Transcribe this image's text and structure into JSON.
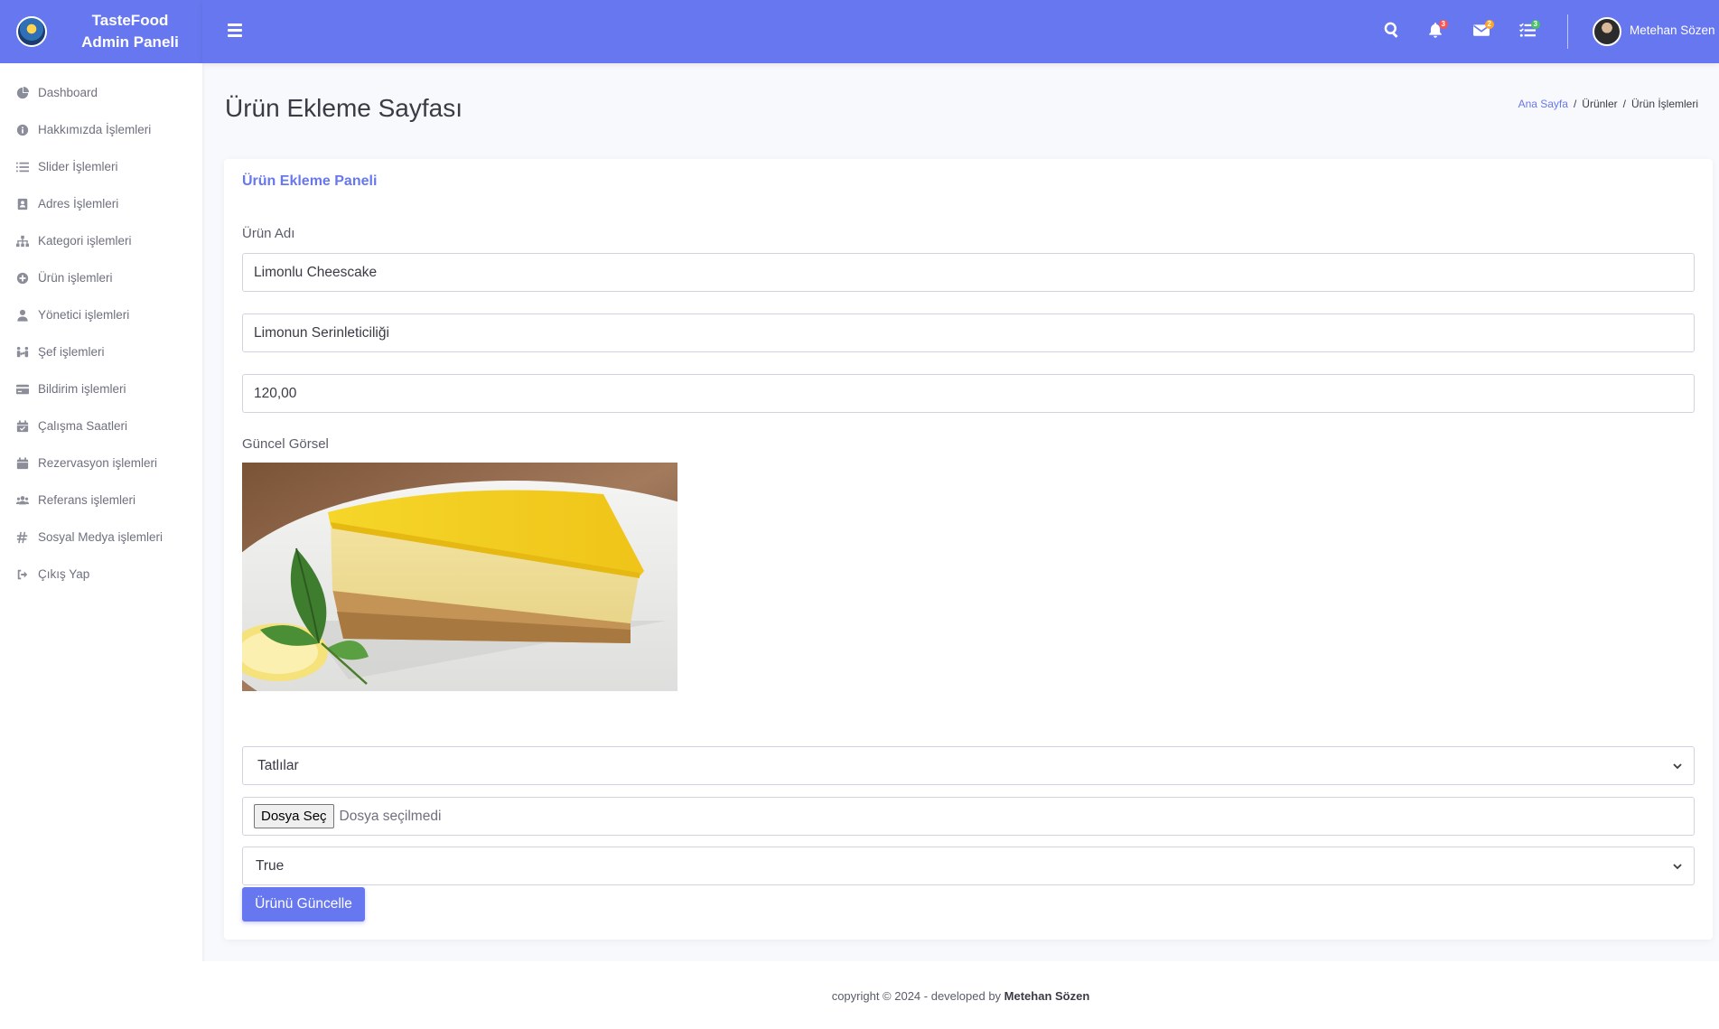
{
  "brand": {
    "line1": "TasteFood",
    "line2": "Admin Paneli"
  },
  "sidebar": {
    "items": [
      {
        "label": "Dashboard",
        "icon": "chart-pie-icon"
      },
      {
        "label": "Hakkımızda İşlemleri",
        "icon": "info-circle-icon"
      },
      {
        "label": "Slider İşlemleri",
        "icon": "list-icon"
      },
      {
        "label": "Adres İşlemleri",
        "icon": "address-book-icon"
      },
      {
        "label": "Kategori işlemleri",
        "icon": "sitemap-icon"
      },
      {
        "label": "Ürün işlemleri",
        "icon": "plus-circle-icon"
      },
      {
        "label": "Yönetici işlemleri",
        "icon": "user-tie-icon"
      },
      {
        "label": "Şef işlemleri",
        "icon": "people-arrows-icon"
      },
      {
        "label": "Bildirim işlemleri",
        "icon": "credit-card-icon"
      },
      {
        "label": "Çalışma Saatleri",
        "icon": "calendar-check-icon"
      },
      {
        "label": "Rezervasyon işlemleri",
        "icon": "calendar-icon"
      },
      {
        "label": "Referans işlemleri",
        "icon": "users-icon"
      },
      {
        "label": "Sosyal Medya işlemleri",
        "icon": "hashtag-icon"
      },
      {
        "label": "Çıkış Yap",
        "icon": "sign-out-icon"
      }
    ]
  },
  "topbar": {
    "notifications_count": "3",
    "messages_count": "2",
    "tasks_count": "3",
    "user_name": "Metehan Sözen",
    "colors": {
      "bar": "#6777ef",
      "badge_red": "#fc544b",
      "badge_yellow": "#ffa426",
      "badge_green": "#47c363"
    }
  },
  "page": {
    "title": "Ürün Ekleme Sayfası",
    "breadcrumb": {
      "home": "Ana Sayfa",
      "section": "Ürünler",
      "current": "Ürün İşlemleri"
    }
  },
  "form": {
    "panel_title": "Ürün Ekleme Paneli",
    "name_label": "Ürün Adı",
    "name_value": "Limonlu Cheescake",
    "description_value": "Limonun Serinleticiliği",
    "price_value": "120,00",
    "image_label": "Güncel Görsel",
    "category_value": "Tatlılar",
    "file_button": "Dosya Seç",
    "file_status": "Dosya seçilmedi",
    "status_value": "True",
    "submit_label": "Ürünü Güncelle"
  },
  "footer": {
    "text": "copyright © 2024 - developed by ",
    "author": "Metehan Sözen"
  }
}
